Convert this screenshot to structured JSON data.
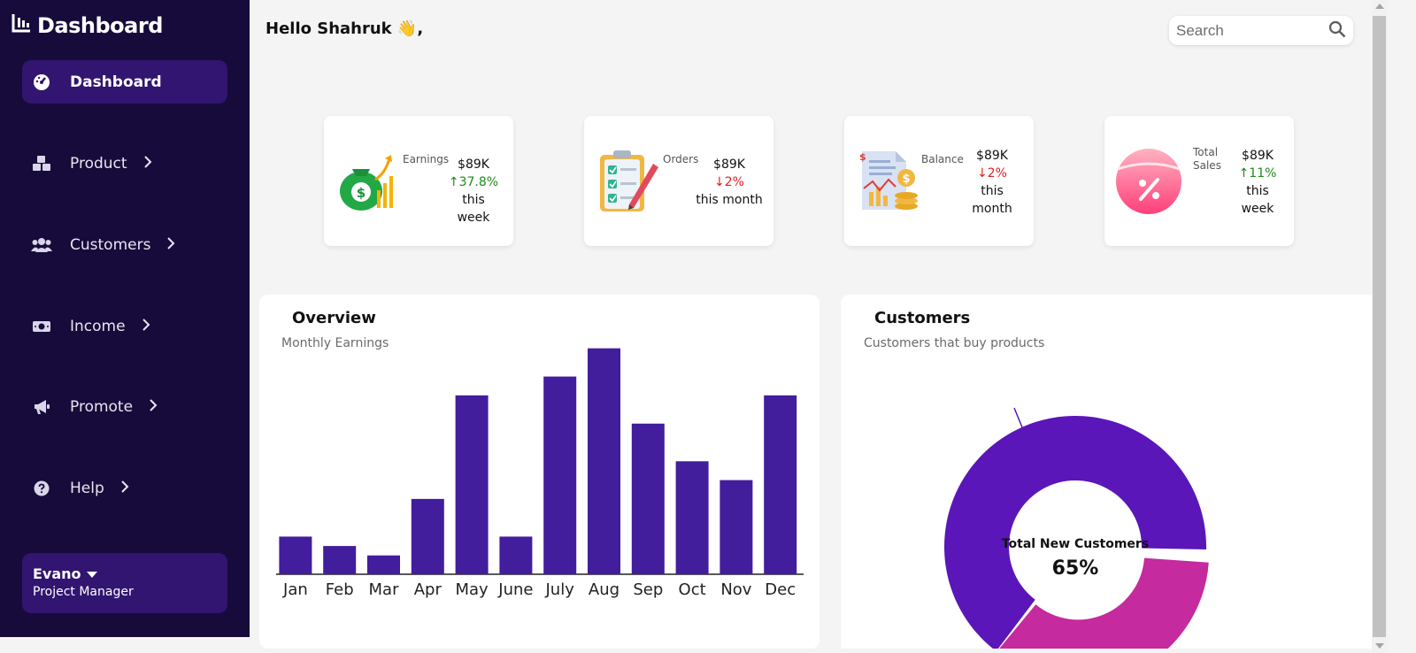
{
  "sidebar": {
    "brand": "Dashboard",
    "items": [
      {
        "label": "Dashboard",
        "icon": "speedometer-icon",
        "active": true
      },
      {
        "label": "Product",
        "icon": "cubes-icon"
      },
      {
        "label": "Customers",
        "icon": "users-icon"
      },
      {
        "label": "Income",
        "icon": "money-icon"
      },
      {
        "label": "Promote",
        "icon": "megaphone-icon"
      },
      {
        "label": "Help",
        "icon": "question-circle-icon"
      }
    ],
    "profile": {
      "name": "Evano",
      "role": "Project Manager"
    }
  },
  "header": {
    "greeting": "Hello Shahruk 👋,",
    "search_placeholder": "Search"
  },
  "stats": [
    {
      "label": "Earnings",
      "value": "$89K",
      "change": "↑37.8%",
      "period": "this week",
      "trend": "up",
      "icon": "money-bag-icon"
    },
    {
      "label": "Orders",
      "value": "$89K",
      "change": "↓2%",
      "period": "this month",
      "trend": "down",
      "icon": "clipboard-icon"
    },
    {
      "label": "Balance",
      "value": "$89K",
      "change": "↓2%",
      "period_line1": "this",
      "period_line2": "month",
      "trend": "down",
      "icon": "report-coins-icon"
    },
    {
      "label_line1": "Total",
      "label_line2": "Sales",
      "value": "$89K",
      "change": "↑11%",
      "period_line1": "this",
      "period_line2": "week",
      "trend": "up",
      "icon": "percent-tag-icon"
    }
  ],
  "overview": {
    "title": "Overview",
    "subtitle": "Monthly Earnings"
  },
  "customers": {
    "title": "Customers",
    "subtitle": "Customers that buy products",
    "center_label": "Total New Customers",
    "center_value": "65%"
  },
  "colors": {
    "sidebar_bg": "#170b3b",
    "active_bg": "#311570",
    "bar": "#421d9c",
    "donut_primary": "#5a16b8",
    "donut_secondary": "#c52a9e"
  },
  "chart_data": [
    {
      "type": "bar",
      "categories": [
        "Jan",
        "Feb",
        "Mar",
        "Apr",
        "May",
        "June",
        "July",
        "Aug",
        "Sep",
        "Oct",
        "Nov",
        "Dec"
      ],
      "values": [
        4,
        3,
        2,
        8,
        19,
        4,
        21,
        24,
        16,
        12,
        10,
        19
      ],
      "ylim": [
        0,
        25
      ],
      "grid": false
    },
    {
      "type": "pie",
      "categories": [
        "",
        ""
      ],
      "values": [
        65,
        35
      ]
    }
  ]
}
